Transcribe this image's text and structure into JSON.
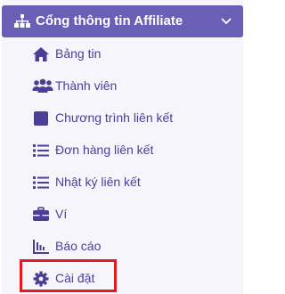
{
  "menu": {
    "title": "Cổng thông tin Affiliate",
    "header_icon": "sitemap-icon",
    "chevron_icon": "chevron-down-icon",
    "items": [
      {
        "label": "Bảng tin",
        "icon": "home-icon"
      },
      {
        "label": "Thành viên",
        "icon": "users-icon"
      },
      {
        "label": "Chương trình liên kết",
        "icon": "square-icon"
      },
      {
        "label": "Đơn hàng liên kết",
        "icon": "list-icon"
      },
      {
        "label": "Nhật ký liên kết",
        "icon": "list-icon"
      },
      {
        "label": "Ví",
        "icon": "briefcase-icon"
      },
      {
        "label": "Báo cáo",
        "icon": "chart-icon"
      },
      {
        "label": "Cài đặt",
        "icon": "gear-icon"
      }
    ],
    "highlighted_item": "Cài đặt"
  },
  "colors": {
    "header_bg": "#6a5fb7",
    "item_text": "#4a3f96",
    "panel_bg": "#f6f5fb",
    "highlight_border": "#e11b22"
  }
}
